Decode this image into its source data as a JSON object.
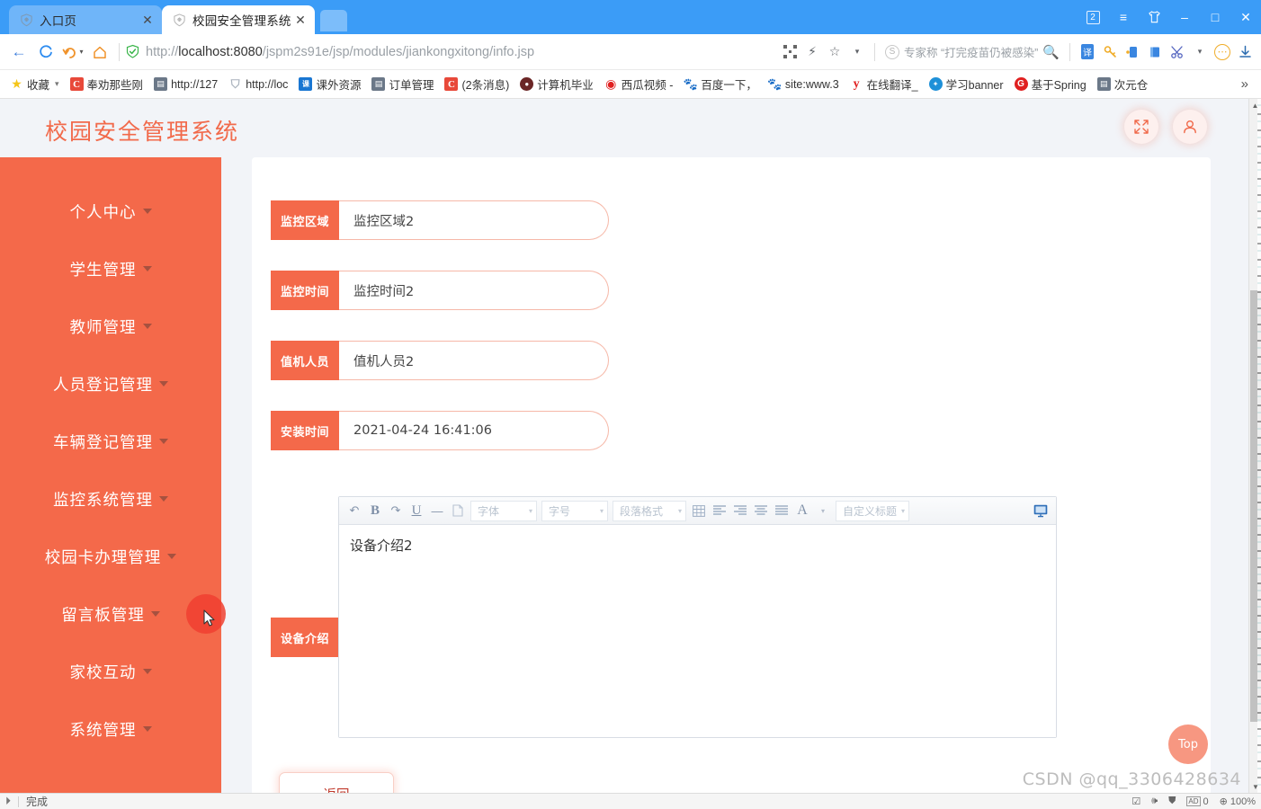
{
  "browser": {
    "tabs": [
      {
        "title": "入口页",
        "active": false,
        "favicon": "shield-icon",
        "close": "✕"
      },
      {
        "title": "校园安全管理系统",
        "active": true,
        "favicon": "shield-icon",
        "close": "✕"
      }
    ],
    "window_controls": {
      "tab_count": "2",
      "menu": "≡",
      "skin": "skin-icon",
      "minimize": "–",
      "maximize": "□",
      "close": "✕"
    },
    "nav": {
      "back": "←",
      "reload": "C",
      "forward_history": "↺",
      "home": "⌂",
      "url_prefix": "http://",
      "url_host": "localhost:8080",
      "url_path": "/jspm2s91e/jsp/modules/jiankongxitong/info.jsp",
      "url_full": "http://localhost:8080/jspm2s91e/jsp/modules/jiankongxitong/info.jsp",
      "qr": "qr-icon",
      "lightning": "⚡",
      "star": "☆",
      "star_caret": "▾",
      "search_engine": "S",
      "search_value": "专家称 “打完疫苗仍被感染”",
      "search_submit": "search-icon",
      "ext_translate": "译",
      "ext_key": "key-icon",
      "ext_device": "device-icon",
      "ext_book": "book-icon",
      "ext_scissors": "scissors-icon",
      "ext_scissors_caret": "▾",
      "ext_more": "⋯",
      "ext_download": "download-icon"
    },
    "bookmarks": [
      {
        "label": "收藏",
        "icon": "star-icon",
        "color": "#f5c518",
        "caret": "▾"
      },
      {
        "label": "奉劝那些刚",
        "icon": "csdn-icon",
        "color": "#e8493a"
      },
      {
        "label": "http://127",
        "icon": "doc-icon",
        "color": "#6b7888"
      },
      {
        "label": "http://loc",
        "icon": "shield-icon",
        "color": "#aab3bd"
      },
      {
        "label": "课外资源",
        "icon": "blue-icon",
        "color": "#1976d2"
      },
      {
        "label": "订单管理",
        "icon": "doc-icon",
        "color": "#6b7888"
      },
      {
        "label": "(2条消息)",
        "icon": "csdn-icon",
        "color": "#e8493a"
      },
      {
        "label": "计算机毕业",
        "icon": "globe-icon",
        "color": "#6b2626"
      },
      {
        "label": "西瓜视频 -",
        "icon": "pin-icon",
        "color": "#e02020"
      },
      {
        "label": "百度一下，",
        "icon": "baidu-icon",
        "color": "#2932e1"
      },
      {
        "label": "site:www.3",
        "icon": "baidu-icon",
        "color": "#2932e1"
      },
      {
        "label": "在线翻译_",
        "icon": "y-icon",
        "color": "#e02020"
      },
      {
        "label": "学习banner",
        "icon": "globe-icon",
        "color": "#1e90d8"
      },
      {
        "label": "基于Spring",
        "icon": "g-icon",
        "color": "#e02020"
      },
      {
        "label": "次元仓",
        "icon": "doc-icon",
        "color": "#6b7888"
      }
    ],
    "bookmarks_overflow": "»"
  },
  "app": {
    "title": "校园安全管理系统",
    "header_buttons": [
      {
        "name": "fullscreen-button",
        "icon": "expand-arrows-icon"
      },
      {
        "name": "user-button",
        "icon": "user-icon"
      }
    ],
    "sidebar": [
      {
        "label": "个人中心"
      },
      {
        "label": "学生管理"
      },
      {
        "label": "教师管理"
      },
      {
        "label": "人员登记管理"
      },
      {
        "label": "车辆登记管理"
      },
      {
        "label": "监控系统管理"
      },
      {
        "label": "校园卡办理管理"
      },
      {
        "label": "留言板管理"
      },
      {
        "label": "家校互动"
      },
      {
        "label": "系统管理"
      }
    ],
    "form": {
      "fields": [
        {
          "label": "监控区域",
          "value": "监控区域2"
        },
        {
          "label": "监控时间",
          "value": "监控时间2"
        },
        {
          "label": "值机人员",
          "value": "值机人员2"
        },
        {
          "label": "安装时间",
          "value": "2021-04-24 16:41:06"
        }
      ],
      "editor": {
        "label": "设备介绍",
        "content": "设备介绍2",
        "toolbar": {
          "undo": "↶",
          "bold": "B",
          "redo": "↷",
          "underline": "U",
          "hr": "—",
          "page": "page-icon",
          "font_family": "字体",
          "font_size": "字号",
          "paragraph": "段落格式",
          "table": "table-icon",
          "align_left": "align-left-icon",
          "align_center": "align-center-icon",
          "align_right": "align-right-icon",
          "align_justify": "align-justify-icon",
          "text_color": "A",
          "custom_title": "自定义标题",
          "caret": "▾",
          "fullscreen": "screen-icon"
        }
      },
      "back_button": "返回"
    },
    "top_button": "Top",
    "watermark": "CSDN @qq_3306428634"
  },
  "statusbar": {
    "icon": "pointer-icon",
    "text": "完成",
    "right": {
      "check": "check-icon",
      "speaker": "speaker-icon",
      "shield": "shield-icon",
      "ad_label": "AD",
      "ad_count": "0",
      "zoom_icon": "⊕",
      "zoom": "100%"
    }
  }
}
